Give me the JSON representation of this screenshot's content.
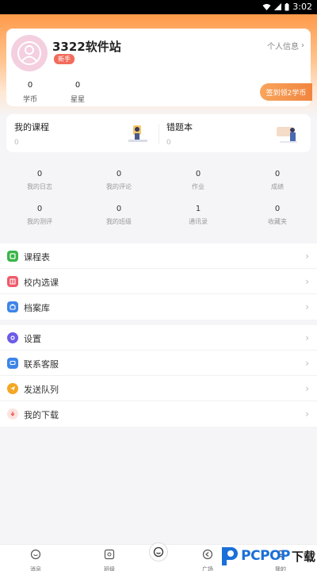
{
  "status_bar": {
    "time": "3:02"
  },
  "profile": {
    "username": "3322软件站",
    "level_badge": "新手",
    "profile_link": "个人信息",
    "stats": [
      {
        "value": "0",
        "label": "学币"
      },
      {
        "value": "0",
        "label": "星星"
      }
    ],
    "signin_button": "签到领2学币"
  },
  "course_section": {
    "my_courses": {
      "title": "我的课程",
      "count": "0"
    },
    "wrong_book": {
      "title": "错题本",
      "count": "0"
    }
  },
  "grid_stats": [
    {
      "value": "0",
      "label": "我的日志"
    },
    {
      "value": "0",
      "label": "我的评论"
    },
    {
      "value": "0",
      "label": "作业"
    },
    {
      "value": "0",
      "label": "成绩"
    },
    {
      "value": "0",
      "label": "我的测评"
    },
    {
      "value": "0",
      "label": "我的班级"
    },
    {
      "value": "1",
      "label": "通讯录"
    },
    {
      "value": "0",
      "label": "收藏夹"
    }
  ],
  "menu_group_1": [
    {
      "label": "课程表",
      "icon": "schedule-icon",
      "color": "#3bb54a"
    },
    {
      "label": "校内选课",
      "icon": "course-select-icon",
      "color": "#ef5b6b"
    },
    {
      "label": "档案库",
      "icon": "archive-icon",
      "color": "#3d84e8"
    }
  ],
  "menu_group_2": [
    {
      "label": "设置",
      "icon": "settings-icon",
      "color": "#6c5ce7"
    },
    {
      "label": "联系客服",
      "icon": "customer-service-icon",
      "color": "#3d84e8"
    },
    {
      "label": "发送队列",
      "icon": "send-queue-icon",
      "color": "#f5a623"
    },
    {
      "label": "我的下载",
      "icon": "download-icon",
      "color": "#ef5b4b"
    }
  ],
  "tab_bar": [
    {
      "label": "消息",
      "icon": "message-icon"
    },
    {
      "label": "班级",
      "icon": "class-icon"
    },
    {
      "label": "",
      "icon": "center-home-icon"
    },
    {
      "label": "广场",
      "icon": "square-icon"
    },
    {
      "label": "我的",
      "icon": "profile-icon"
    }
  ],
  "watermark": {
    "brand": "PCPOP",
    "suffix": "下载"
  }
}
